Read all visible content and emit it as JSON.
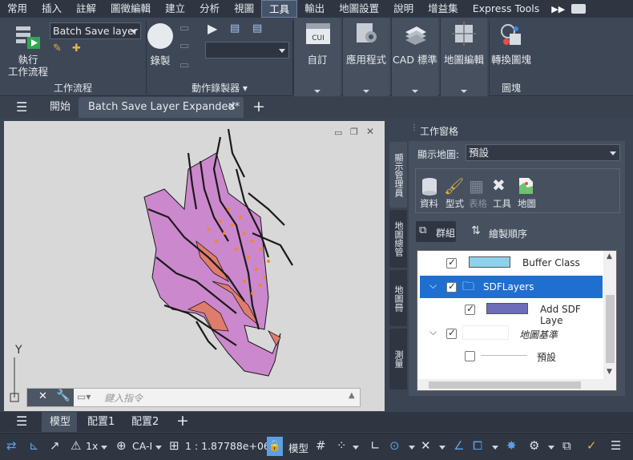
{
  "menu": {
    "items": [
      "常用",
      "插入",
      "註解",
      "圖徵編輯",
      "建立",
      "分析",
      "視圖",
      "工具",
      "輸出",
      "地圖設置",
      "說明",
      "增益集",
      "Express Tools"
    ],
    "active_index": 7
  },
  "ribbon": {
    "workflow": {
      "run_label": "執行",
      "run_label2": "工作流程",
      "combo_value": "Batch Save layer",
      "panel_title": "工作流程"
    },
    "recorder": {
      "record_label": "錄製",
      "panel_title": "動作錄製器 ▾"
    },
    "tools": [
      {
        "label": "自訂",
        "badge": "CUI",
        "icon": "cui-icon"
      },
      {
        "label": "應用程式",
        "icon": "app-gear-icon"
      },
      {
        "label": "CAD 標準",
        "icon": "cad-standard-icon"
      },
      {
        "label": "地圖編輯",
        "icon": "map-edit-icon"
      }
    ],
    "block": {
      "label": "轉換圖塊",
      "panel_title": "圖塊"
    }
  },
  "doc_tabs": {
    "start": "開始",
    "active": "Batch Save Layer Expanded*"
  },
  "drawing": {
    "axis_y": "Y",
    "cmd_placeholder": "鍵入指令"
  },
  "palette": {
    "title": "工作窗格",
    "side_tabs": [
      "顯示管理員",
      "地圖總管",
      "地圖冊",
      "測量"
    ],
    "display_label": "顯示地圖:",
    "display_value": "預設",
    "buttons": [
      "資料",
      "型式",
      "表格",
      "工具",
      "地圖"
    ],
    "group_label": "群組",
    "draw_order_label": "繪製順序",
    "layers": [
      {
        "name": "Buffer Class",
        "indent": 0,
        "swatch": "#8dd2ea"
      },
      {
        "name": "SDFLayers",
        "indent": 0,
        "selected": true
      },
      {
        "name": "Add SDF Laye",
        "indent": 1,
        "swatch": "#6d6db8"
      },
      {
        "name": "地圖基準",
        "indent": 0,
        "italic": true
      },
      {
        "name": "預設",
        "indent": 1,
        "unchecked": true
      }
    ]
  },
  "layout_tabs": [
    "模型",
    "配置1",
    "配置2"
  ],
  "status": {
    "scale_factor": "1x",
    "cs": "CA-I",
    "scale": "1 : 1.87788e+06",
    "model": "模型"
  },
  "colors": {
    "accent": "#1e6fd0",
    "purple": "#cc88cc",
    "salmon": "#e07c6c",
    "orange": "#f08a1e"
  }
}
